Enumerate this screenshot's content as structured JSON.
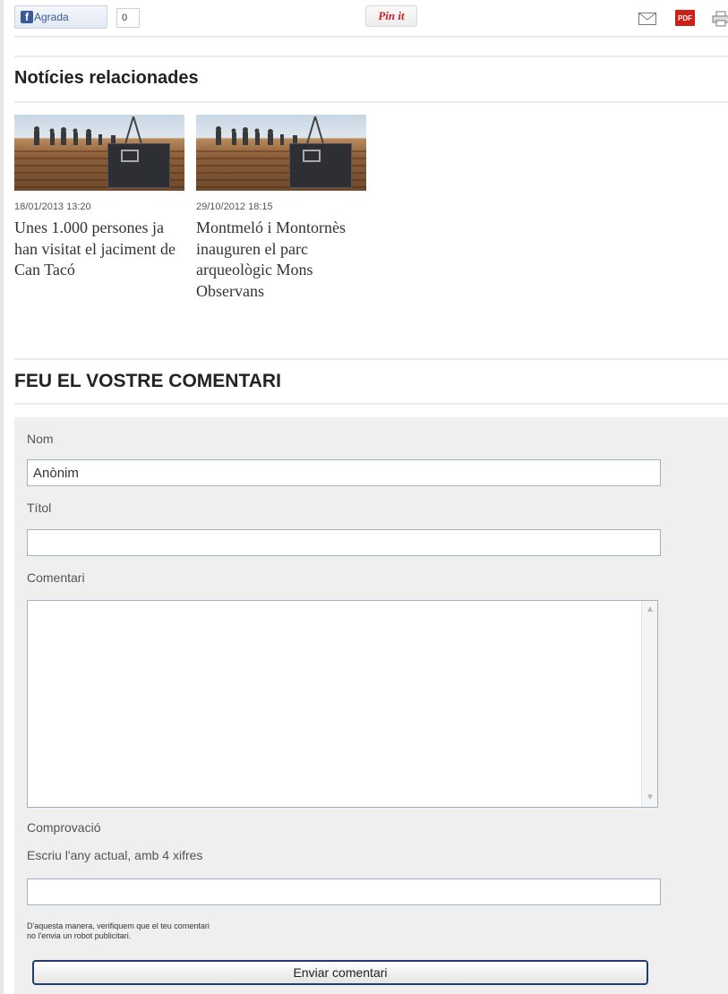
{
  "share": {
    "fb_label": "Agrada",
    "fb_count": "0",
    "pin_label": "Pin it",
    "pdf_label": "PDF"
  },
  "related": {
    "title": "Notícies relacionades",
    "items": [
      {
        "date": "18/01/2013 13:20",
        "headline": "Unes 1.000 persones ja han visitat el jaciment de Can Tacó"
      },
      {
        "date": "29/10/2012 18:15",
        "headline": "Montmeló i Montornès inauguren el parc arqueològic Mons Observans"
      }
    ]
  },
  "form": {
    "title": "FEU EL VOSTRE COMENTARI",
    "name_label": "Nom",
    "name_value": "Anònim",
    "title_label": "Títol",
    "title_value": "",
    "comment_label": "Comentari",
    "check_label": "Comprovació",
    "check_hint": "Escriu l'any actual, amb 4 xifres",
    "check_value": "",
    "note_line1": "D'aquesta manera, verifiquem que el teu comentari",
    "note_line2": "no l'envia un robot publicitari.",
    "submit_label": "Enviar comentari"
  },
  "icons": {
    "facebook": "facebook-icon",
    "pinterest": "pinterest-icon",
    "mail": "mail-icon",
    "pdf": "pdf-icon",
    "print": "print-icon"
  },
  "colors": {
    "facebook_blue": "#3b5998",
    "pinterest_red": "#cb2027",
    "pdf_red": "#cc1f1a",
    "button_border": "#1f3e6e"
  }
}
